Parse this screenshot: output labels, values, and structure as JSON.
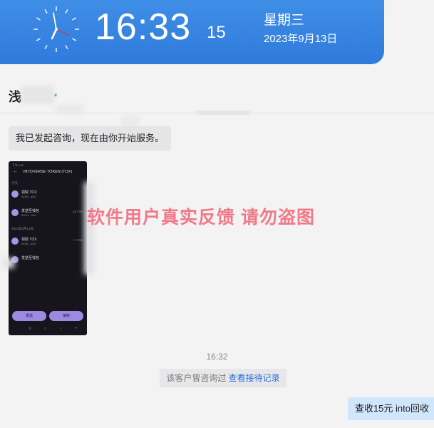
{
  "clock": {
    "time_main": "16:33",
    "time_seconds": "15",
    "weekday": "星期三",
    "date": "2023年9月13日"
  },
  "chat_header": {
    "name_visible": "浅"
  },
  "messages": {
    "agent_message": "我已发起咨询，现在由你开始服务。",
    "timestamp": "16:32",
    "notice_text": "该客户曾咨询过 ",
    "notice_link": "查看接待记录",
    "customer_message": "查收15元 into回收"
  },
  "screenshot_attachment": {
    "status_time": "下午4:32",
    "title": "INTOVERSE TOKEN (TOX)",
    "section_1": "今天",
    "section_2": "2023年9月13日",
    "rows": [
      {
        "line1": "领取 TOX",
        "line2": "0x3f4...a8d",
        "amount": ""
      },
      {
        "line1": "发送至钱包",
        "line2": "0x91c...2be",
        "amount": "-15 TOX"
      },
      {
        "line1": "领取 TOX",
        "line2": "0x3f4...a8d",
        "amount": "+7 TOX"
      },
      {
        "line1": "发送至钱包",
        "line2": "",
        "amount": ""
      }
    ],
    "btn_left": "发送",
    "btn_right": "接收",
    "nav": [
      "≡",
      "○",
      "‹",
      "+"
    ]
  },
  "watermark": "软件用户真实反馈  请勿盗图",
  "colors": {
    "clock_bar": "#2f7bdc",
    "watermark": "#f07a8a",
    "customer_bubble": "#cfe6fb",
    "link": "#2f6fd6"
  }
}
